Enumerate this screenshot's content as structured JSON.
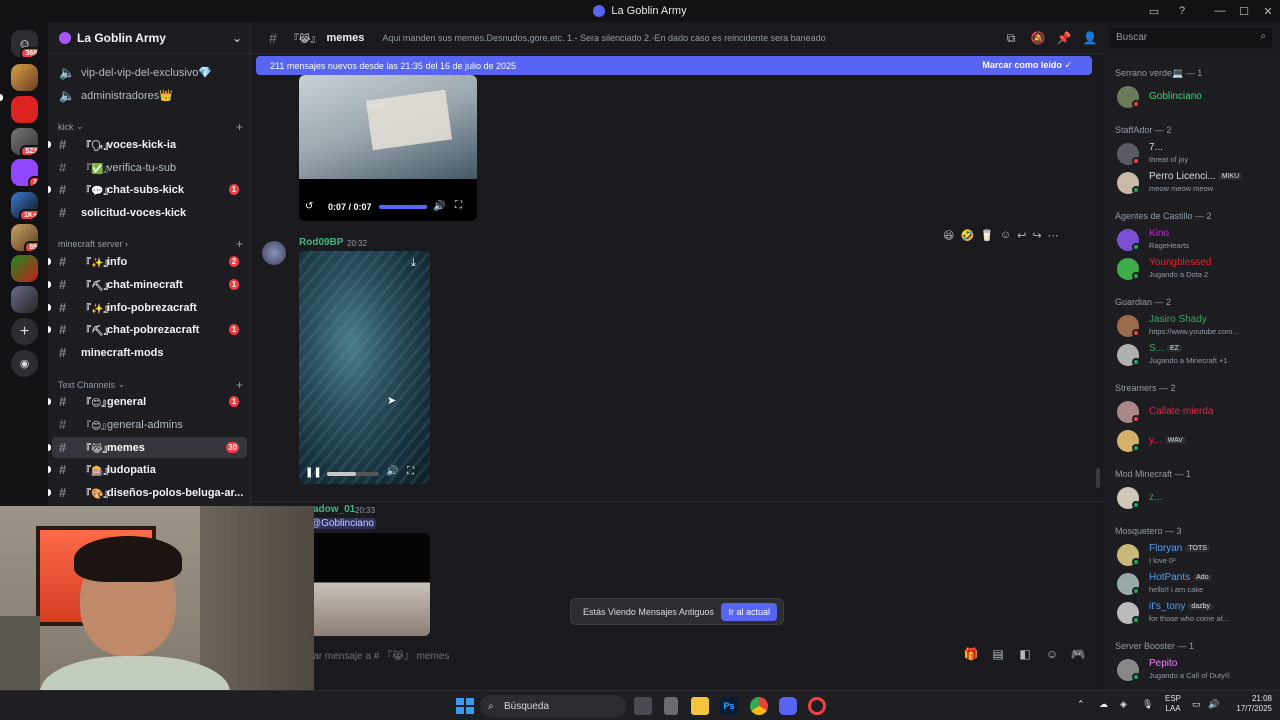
{
  "window": {
    "title": "La Goblin Army"
  },
  "server_rail": {
    "badges": [
      "369",
      "523",
      "3",
      "1K+",
      "89"
    ],
    "items": [
      "discord-home",
      "server-1",
      "server-pesist",
      "server-3",
      "server-twitch",
      "server-5",
      "server-6",
      "server-7",
      "server-8",
      "add-server",
      "discover"
    ]
  },
  "guild": {
    "name": "La Goblin Army"
  },
  "channels": {
    "top": [
      {
        "emoji": "💎",
        "name": "vip-del-vip-del-exclusivo💎"
      },
      {
        "emoji": "👑",
        "name": "administradores👑"
      }
    ],
    "categories": [
      {
        "name": "kick",
        "items": [
          {
            "emoji": "『🗣』",
            "name": "voces-kick-ia",
            "unread": true,
            "count": ""
          },
          {
            "emoji": "『✅』",
            "name": "verifica-tu-sub",
            "unread": false,
            "count": ""
          },
          {
            "emoji": "『💬』",
            "name": "chat-subs-kick",
            "unread": true,
            "count": "1"
          },
          {
            "emoji": "",
            "name": "solicitud-voces-kick",
            "unread": true,
            "count": ""
          }
        ]
      },
      {
        "name": "minecraft server",
        "items": [
          {
            "emoji": "『✨』",
            "name": "info",
            "unread": true,
            "count": "2"
          },
          {
            "emoji": "『⛏』",
            "name": "chat-minecraft",
            "unread": true,
            "count": "1"
          },
          {
            "emoji": "『✨』",
            "name": "info-pobrezacraft",
            "unread": true,
            "count": ""
          },
          {
            "emoji": "『⛏』",
            "name": "chat-pobrezacraft",
            "unread": true,
            "count": "1"
          },
          {
            "emoji": "",
            "name": "minecraft-mods",
            "unread": true,
            "count": ""
          }
        ]
      },
      {
        "name": "Text Channels",
        "items": [
          {
            "emoji": "『😊』",
            "name": "general",
            "unread": true,
            "count": "1"
          },
          {
            "emoji": "『😊』",
            "name": "general-admins",
            "unread": false,
            "count": ""
          },
          {
            "emoji": "『😹』",
            "name": "memes",
            "unread": true,
            "count": "30",
            "active": true
          },
          {
            "emoji": "『🎰』",
            "name": "ludopatia",
            "unread": true,
            "count": ""
          },
          {
            "emoji": "『🎨』",
            "name": "diseños-polos-beluga-ar...",
            "unread": true,
            "count": ""
          }
        ]
      }
    ]
  },
  "header": {
    "channel_emoji": "『😹』",
    "channel_name": "memes",
    "topic": "Aqui manden sus memes.Desnudos,gore,etc. 1.- Sera silenciado 2.-En dado caso es reincidente sera baneado",
    "search_placeholder": "Buscar"
  },
  "new_messages": {
    "text": "211 mensajes nuevos desde las 21:35 del 16 de julio de 2025",
    "mark_read": "Marcar como leído"
  },
  "messages": [
    {
      "video_time": "0:07 / 0:07",
      "video_progress": 1.0
    },
    {
      "user": "Rod09BP",
      "time": "20:32",
      "video_progress": 0.55,
      "reactions": [
        "😆",
        "🤣"
      ]
    },
    {
      "user": "adow_01",
      "time": "20:33",
      "mention": "Goblinciano"
    }
  ],
  "old_messages": {
    "text": "Estás Viendo Mensajes Antiguos",
    "button": "Ir al actual"
  },
  "composer": {
    "placeholder": "viar mensaje a # 『😹』 memes"
  },
  "members": {
    "groups": [
      {
        "role": "Serrano verde💻 — 1",
        "members": [
          {
            "name": "Goblinciano",
            "color": "#43d36b",
            "status": "",
            "tag": "",
            "presence": "dnd"
          }
        ]
      },
      {
        "role": "StaffAdor — 2",
        "members": [
          {
            "name": "7...",
            "color": "#dbdee1",
            "status": "threat of joy",
            "tag": "",
            "presence": "dnd"
          },
          {
            "name": "Perro Licenci...",
            "color": "#dbdee1",
            "status": "meow meow meow",
            "tag": "MIKU",
            "presence": "online"
          }
        ]
      },
      {
        "role": "Agentes de Castillo — 2",
        "members": [
          {
            "name": "Kino",
            "color": "#c026d3",
            "status": "RageHearts",
            "tag": "",
            "presence": "online"
          },
          {
            "name": "Youngblessed",
            "color": "#e02424",
            "status": "Jugando a Dota 2",
            "tag": "",
            "presence": "online"
          }
        ]
      },
      {
        "role": "Guardian — 2",
        "members": [
          {
            "name": "Jasiro Shady",
            "color": "#3ba55c",
            "status": "https://www.youtube.com...",
            "tag": "",
            "presence": "dnd"
          },
          {
            "name": "S...",
            "color": "#3ba55c",
            "status": "Jugando a Minecraft +1",
            "tag": "EZ",
            "presence": "online"
          }
        ]
      },
      {
        "role": "Streamers — 2",
        "members": [
          {
            "name": "Callate mierda",
            "color": "#e02449",
            "status": "",
            "tag": "",
            "presence": "dnd"
          },
          {
            "name": "y...",
            "color": "#e02449",
            "status": "",
            "tag": "WAV",
            "presence": "online"
          }
        ]
      },
      {
        "role": "Mod Minecraft — 1",
        "members": [
          {
            "name": "z...",
            "color": "#3ba55c",
            "status": "",
            "tag": "",
            "presence": "online"
          }
        ]
      },
      {
        "role": "Mosquetero — 3",
        "members": [
          {
            "name": "Floryan",
            "color": "#4ea1f0",
            "status": "I love 0²",
            "tag": "TOTS",
            "presence": "online"
          },
          {
            "name": "HotPants",
            "color": "#4ea1f0",
            "status": "hello!! i am cake",
            "tag": "Ado",
            "presence": "online"
          },
          {
            "name": "it's_tony",
            "color": "#4ea1f0",
            "status": "for those who come af...",
            "tag": "dazby",
            "presence": "online"
          }
        ]
      },
      {
        "role": "Server Booster — 1",
        "members": [
          {
            "name": "Pepito",
            "color": "#f47fff",
            "status": "Jugando a Call of Duty®",
            "tag": "",
            "presence": "online"
          }
        ]
      }
    ]
  },
  "taskbar": {
    "search": "Búsqueda",
    "lang_top": "ESP",
    "lang_bottom": "LAA",
    "clock_time": "21:08",
    "clock_date": "17/7/2025"
  },
  "colors": {
    "accent": "#5865f2",
    "danger": "#f23f43",
    "online": "#23a55a",
    "dnd": "#f23f43"
  }
}
